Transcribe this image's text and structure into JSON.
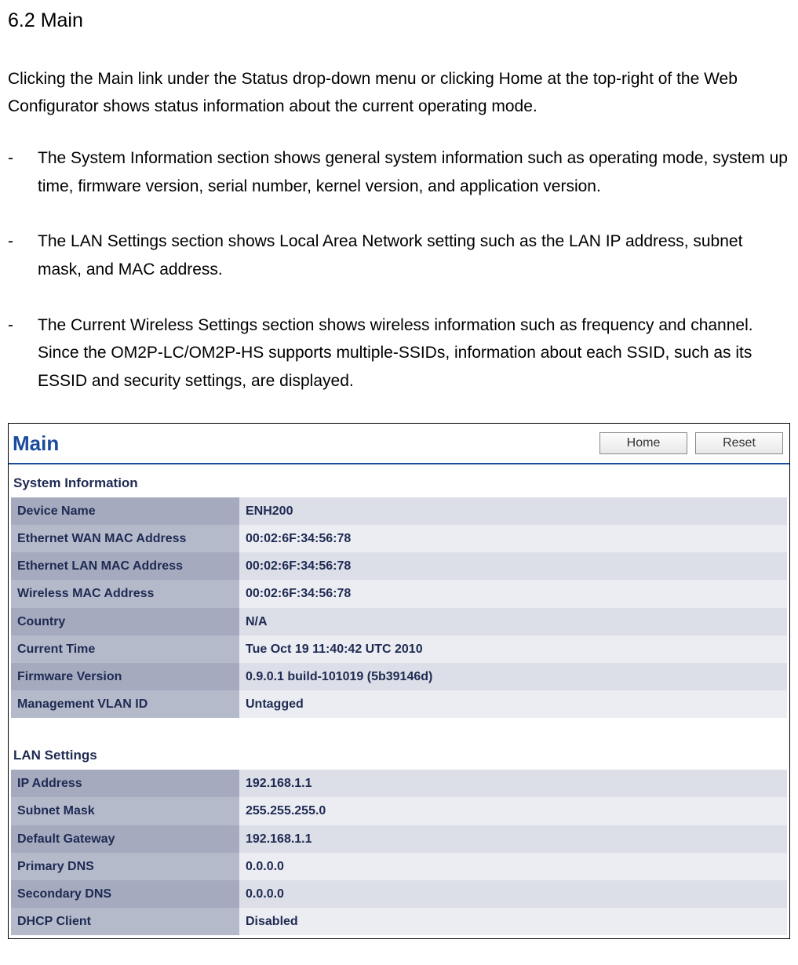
{
  "heading": "6.2 Main",
  "intro": "Clicking the Main link under the Status drop-down menu or clicking Home at the top-right of the Web Configurator shows status information about the current operating mode.",
  "bullets": [
    "The System Information section shows general system information such as operating mode, system up time, firmware version, serial number, kernel version, and application version.",
    "The LAN Settings section shows Local Area Network setting such as the LAN IP address, subnet mask, and MAC address.",
    "The Current Wireless Settings section shows wireless information such as frequency and channel. Since the OM2P-LC/OM2P-HS supports multiple-SSIDs, information about each SSID, such as its ESSID and security settings, are displayed."
  ],
  "ui": {
    "title": "Main",
    "buttons": {
      "home": "Home",
      "reset": "Reset"
    },
    "systemInfo": {
      "title": "System Information",
      "rows": [
        {
          "label": "Device Name",
          "value": "ENH200"
        },
        {
          "label": "Ethernet WAN MAC Address",
          "value": "00:02:6F:34:56:78"
        },
        {
          "label": "Ethernet LAN MAC Address",
          "value": "00:02:6F:34:56:78"
        },
        {
          "label": "Wireless MAC Address",
          "value": "00:02:6F:34:56:78"
        },
        {
          "label": "Country",
          "value": "N/A"
        },
        {
          "label": "Current Time",
          "value": "Tue Oct 19 11:40:42 UTC 2010"
        },
        {
          "label": "Firmware Version",
          "value": "0.9.0.1 build-101019 (5b39146d)"
        },
        {
          "label": "Management VLAN ID",
          "value": "Untagged"
        }
      ]
    },
    "lanSettings": {
      "title": "LAN Settings",
      "rows": [
        {
          "label": "IP Address",
          "value": "192.168.1.1"
        },
        {
          "label": "Subnet Mask",
          "value": "255.255.255.0"
        },
        {
          "label": "Default Gateway",
          "value": "192.168.1.1"
        },
        {
          "label": "Primary DNS",
          "value": "0.0.0.0"
        },
        {
          "label": "Secondary DNS",
          "value": "0.0.0.0"
        },
        {
          "label": "DHCP Client",
          "value": "Disabled"
        }
      ]
    }
  }
}
